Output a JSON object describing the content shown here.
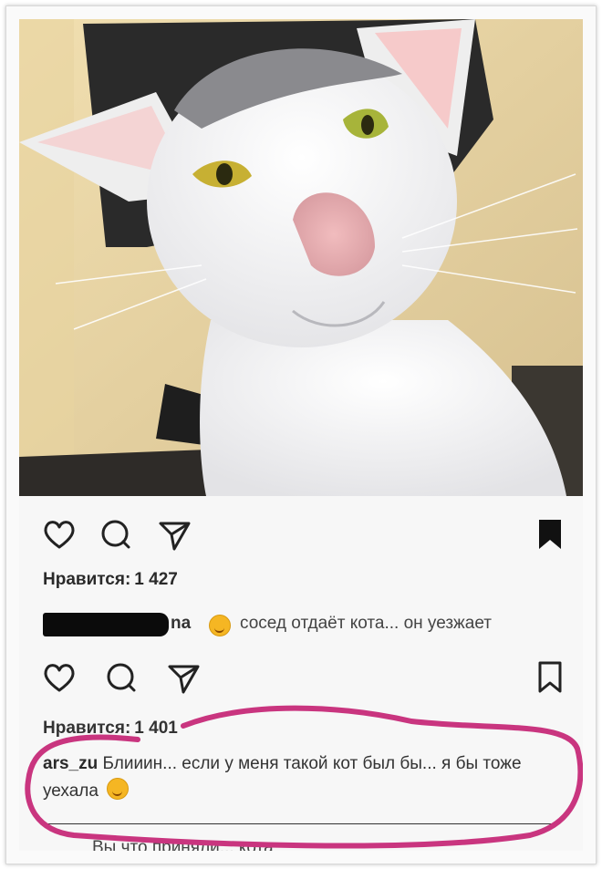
{
  "post": {
    "image_alt": "White cat selfie",
    "likes_label": "Нравится:",
    "likes_count": "1 427",
    "comment": {
      "username_fragment": "na",
      "text": "сосед отдаёт кота... он уезжает"
    },
    "colors": {
      "text": "#2a2a2a",
      "emoji": "#f5b623",
      "highlight": "#c9357f"
    }
  },
  "repost": {
    "likes_label": "Нравится:",
    "likes_count": "1 401",
    "comment": {
      "username": "ars_zu",
      "text": "Блииин... если у меня такой кот был бы... я бы тоже уехала"
    },
    "next_comment_fragment": "Вы что приняли... кота"
  },
  "icons": [
    "heart-icon",
    "comment-icon",
    "share-icon",
    "bookmark-icon"
  ]
}
